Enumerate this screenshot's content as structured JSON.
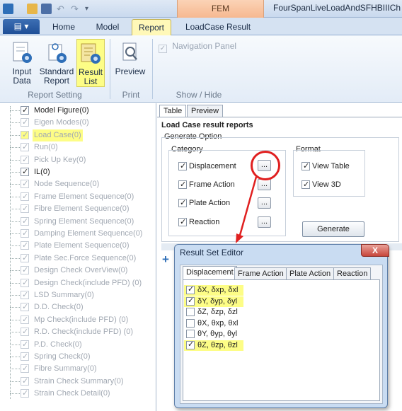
{
  "titlebar": {
    "context_tab": "FEM",
    "doc_title": "FourSpanLiveLoadAndSFHBIIICh"
  },
  "ribbon": {
    "tabs": [
      "Home",
      "Model",
      "Report",
      "LoadCase Result"
    ],
    "active_tab": "Report",
    "buttons": {
      "input_data": "Input\nData",
      "input_data_l1": "Input",
      "input_data_l2": "Data",
      "standard_report_l1": "Standard",
      "standard_report_l2": "Report",
      "result_list_l1": "Result",
      "result_list_l2": "List",
      "preview": "Preview",
      "navigation_panel": "Navigation Panel"
    },
    "groups": {
      "report_setting": "Report Setting",
      "print": "Print",
      "show_hide": "Show / Hide"
    }
  },
  "tree": {
    "items": [
      {
        "label": "Model Figure(0)",
        "checked": true,
        "dim": false,
        "hl": false
      },
      {
        "label": "Eigen Modes(0)",
        "checked": true,
        "dim": true,
        "hl": false
      },
      {
        "label": "Load Case(0)",
        "checked": true,
        "dim": true,
        "hl": true
      },
      {
        "label": "Run(0)",
        "checked": true,
        "dim": true,
        "hl": false
      },
      {
        "label": "Pick Up Key(0)",
        "checked": true,
        "dim": true,
        "hl": false
      },
      {
        "label": "IL(0)",
        "checked": true,
        "dim": false,
        "hl": false
      },
      {
        "label": "Node Sequence(0)",
        "checked": true,
        "dim": true,
        "hl": false
      },
      {
        "label": "Frame Element Sequence(0)",
        "checked": true,
        "dim": true,
        "hl": false
      },
      {
        "label": "Fibre Element Sequence(0)",
        "checked": true,
        "dim": true,
        "hl": false
      },
      {
        "label": "Spring Element Sequence(0)",
        "checked": true,
        "dim": true,
        "hl": false
      },
      {
        "label": "Damping Element Sequence(0)",
        "checked": true,
        "dim": true,
        "hl": false
      },
      {
        "label": "Plate Element Sequence(0)",
        "checked": true,
        "dim": true,
        "hl": false
      },
      {
        "label": "Plate Sec.Force Sequence(0)",
        "checked": true,
        "dim": true,
        "hl": false
      },
      {
        "label": "Design Check OverView(0)",
        "checked": true,
        "dim": true,
        "hl": false
      },
      {
        "label": "Design Check(include PFD) (0)",
        "checked": true,
        "dim": true,
        "hl": false
      },
      {
        "label": "LSD Summary(0)",
        "checked": true,
        "dim": true,
        "hl": false
      },
      {
        "label": "D.D. Check(0)",
        "checked": true,
        "dim": true,
        "hl": false
      },
      {
        "label": "Mp Check(include PFD) (0)",
        "checked": true,
        "dim": true,
        "hl": false
      },
      {
        "label": "R.D. Check(include PFD) (0)",
        "checked": true,
        "dim": true,
        "hl": false
      },
      {
        "label": "P.D. Check(0)",
        "checked": true,
        "dim": true,
        "hl": false
      },
      {
        "label": "Spring Check(0)",
        "checked": true,
        "dim": true,
        "hl": false
      },
      {
        "label": "Fibre Summary(0)",
        "checked": true,
        "dim": true,
        "hl": false
      },
      {
        "label": "Strain Check Summary(0)",
        "checked": true,
        "dim": true,
        "hl": false
      },
      {
        "label": "Strain Check Detail(0)",
        "checked": true,
        "dim": true,
        "hl": false
      }
    ]
  },
  "panel": {
    "tabs": [
      "Table",
      "Preview"
    ],
    "heading": "Load Case result reports",
    "generate_option": "Generate Option",
    "category_label": "Category",
    "category": [
      "Displacement",
      "Frame Action",
      "Plate Action",
      "Reaction"
    ],
    "format_label": "Format",
    "format": [
      "View Table",
      "View 3D"
    ],
    "generate_button": "Generate",
    "dots": "..."
  },
  "dialog": {
    "title": "Result Set Editor",
    "close": "X",
    "tabs": [
      "Displacement",
      "Frame Action",
      "Plate Action",
      "Reaction"
    ],
    "items": [
      {
        "label": "δX, δxp, δxl",
        "checked": true,
        "hl": true
      },
      {
        "label": "δY, δyp, δyl",
        "checked": true,
        "hl": true
      },
      {
        "label": "δZ, δzp, δzl",
        "checked": false,
        "hl": false
      },
      {
        "label": "θX, θxp, θxl",
        "checked": false,
        "hl": false
      },
      {
        "label": "θY, θyp, θyl",
        "checked": false,
        "hl": false
      },
      {
        "label": "θZ, θzp, θzl",
        "checked": true,
        "hl": true
      }
    ]
  },
  "colors": {
    "highlight": "#fdfd86",
    "annotation_red": "#e02020",
    "ribbon_active": "#fff8b8",
    "context_tab": "#f6b890"
  }
}
